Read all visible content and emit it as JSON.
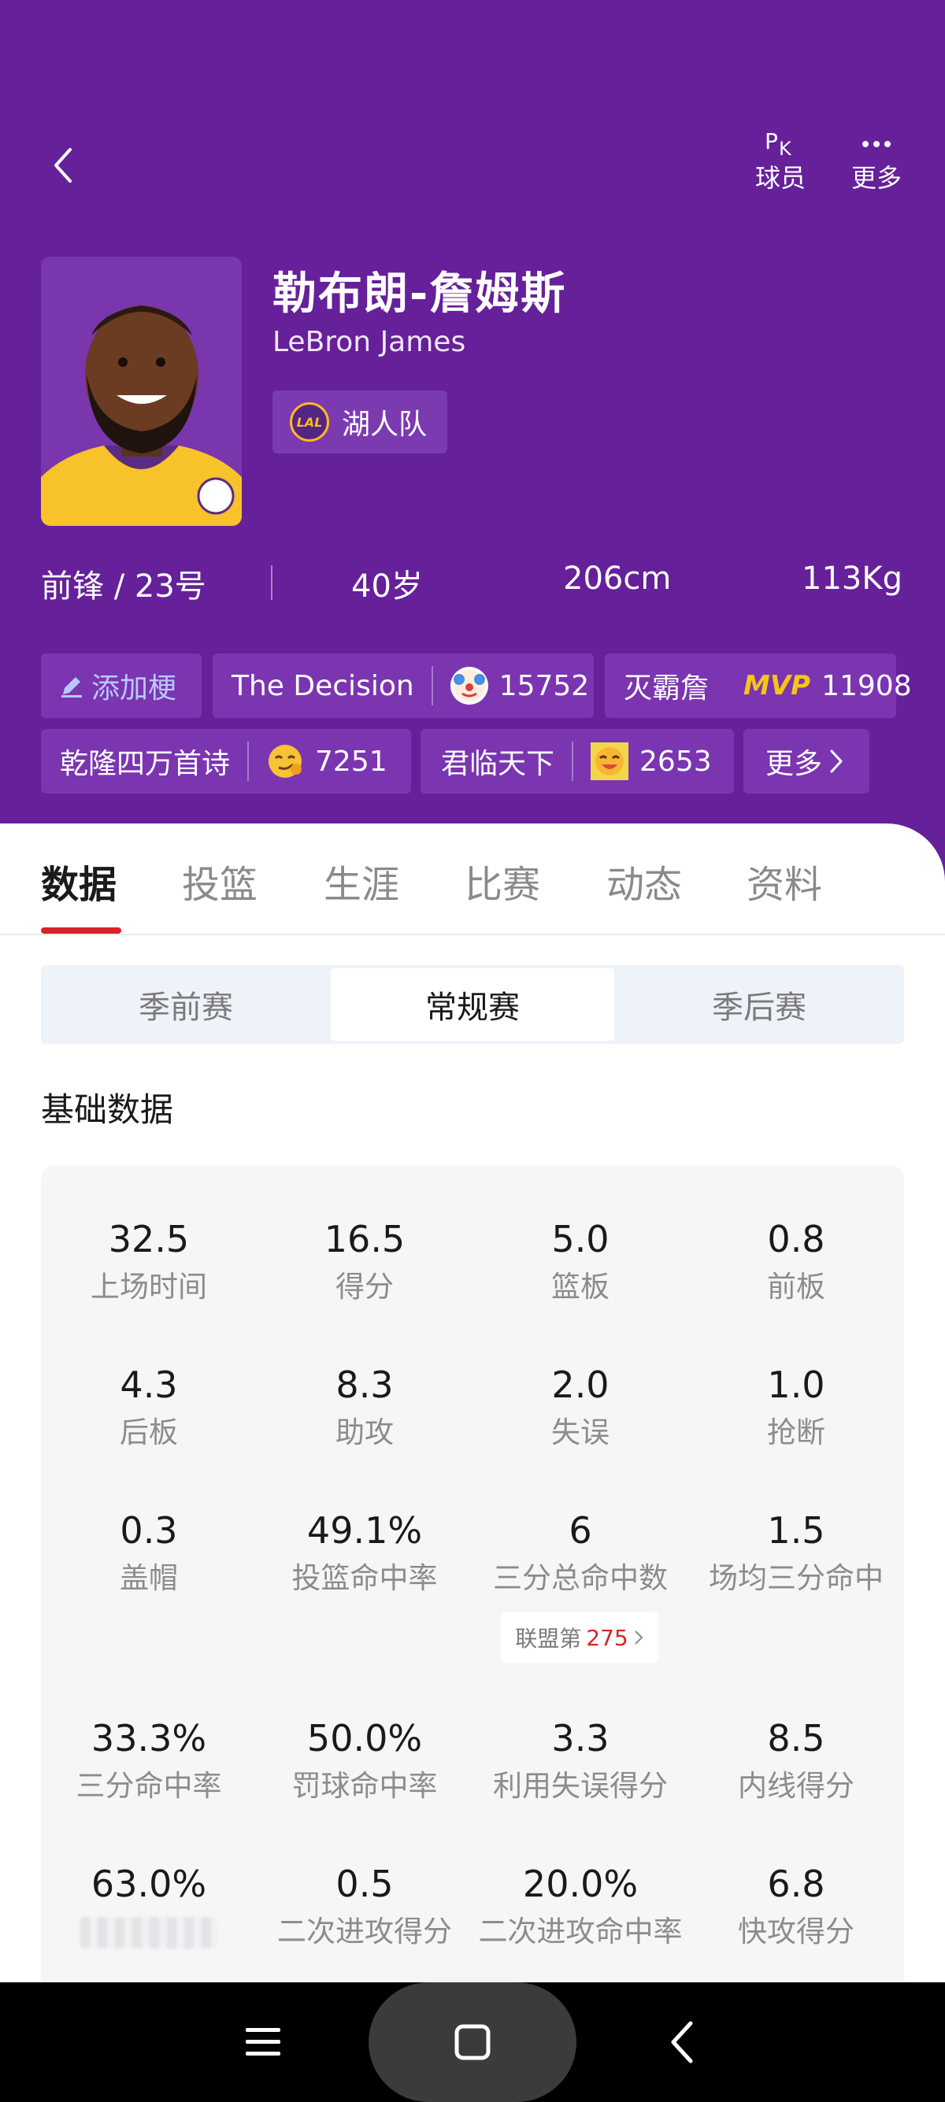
{
  "header": {
    "actions": [
      {
        "id": "pk",
        "icon": "pk-icon",
        "label": "球员"
      },
      {
        "id": "more",
        "icon": "more-dots-icon",
        "label": "更多"
      }
    ]
  },
  "player": {
    "name_cn": "勒布朗-詹姆斯",
    "name_en": "LeBron James",
    "team": "湖人队",
    "team_logo_text": "LAL",
    "position_number": "前锋 / 23号",
    "age": "40岁",
    "height": "206cm",
    "weight": "113Kg"
  },
  "tags": {
    "add_label": "添加梗",
    "items": [
      {
        "text": "The Decision",
        "emoji": "clown-emoji",
        "count": "15752"
      },
      {
        "text": "灭霸詹",
        "emoji": "mvp-badge",
        "emoji_text": "MVP",
        "count": "11908"
      },
      {
        "text": "乾隆四万首诗",
        "emoji": "smirk-emoji",
        "count": "7251"
      },
      {
        "text": "君临天下",
        "emoji": "laugh-emoji",
        "count": "2653"
      }
    ],
    "more_label": "更多"
  },
  "tabs": [
    "数据",
    "投篮",
    "生涯",
    "比赛",
    "动态",
    "资料"
  ],
  "active_tab": "数据",
  "season_types": [
    "季前赛",
    "常规赛",
    "季后赛"
  ],
  "active_season_type": "常规赛",
  "section_title": "基础数据",
  "stats": [
    {
      "value": "32.5",
      "label": "上场时间"
    },
    {
      "value": "16.5",
      "label": "得分"
    },
    {
      "value": "5.0",
      "label": "篮板"
    },
    {
      "value": "0.8",
      "label": "前板"
    },
    {
      "value": "4.3",
      "label": "后板"
    },
    {
      "value": "8.3",
      "label": "助攻"
    },
    {
      "value": "2.0",
      "label": "失误"
    },
    {
      "value": "1.0",
      "label": "抢断"
    },
    {
      "value": "0.3",
      "label": "盖帽"
    },
    {
      "value": "49.1%",
      "label": "投篮命中率"
    },
    {
      "value": "6",
      "label": "三分总命中数"
    },
    {
      "value": "1.5",
      "label": "场均三分命中"
    },
    {
      "value": "33.3%",
      "label": "三分命中率"
    },
    {
      "value": "50.0%",
      "label": "罚球命中率"
    },
    {
      "value": "3.3",
      "label": "利用失误得分"
    },
    {
      "value": "8.5",
      "label": "内线得分"
    },
    {
      "value": "63.0%",
      "label": ""
    },
    {
      "value": "0.5",
      "label": "二次进攻得分"
    },
    {
      "value": "20.0%",
      "label": "二次进攻命中率"
    },
    {
      "value": "6.8",
      "label": "快攻得分"
    }
  ],
  "rank": {
    "prefix": "联盟第",
    "value": "275"
  },
  "colors": {
    "hero_bg": "#65209a",
    "accent_red": "#d8232a",
    "tag_bg": "#7b35b0"
  }
}
